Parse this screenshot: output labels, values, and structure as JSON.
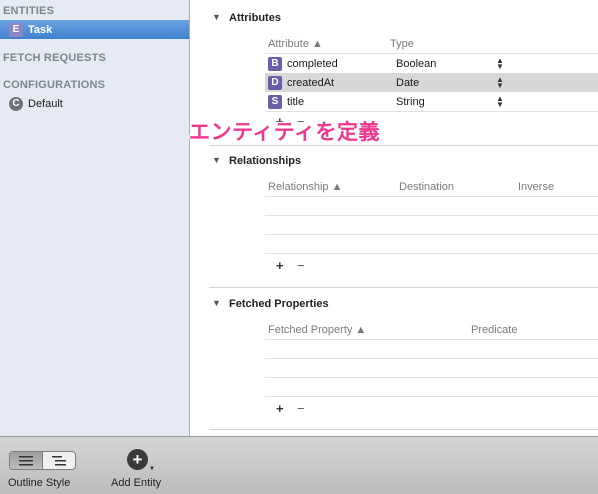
{
  "sidebar": {
    "entities_header": "ENTITIES",
    "entities": [
      {
        "badge": "E",
        "label": "Task"
      }
    ],
    "fetch_requests_header": "FETCH REQUESTS",
    "configurations_header": "CONFIGURATIONS",
    "configurations": [
      {
        "badge": "C",
        "label": "Default"
      }
    ]
  },
  "attributes": {
    "title": "Attributes",
    "col_attribute": "Attribute ▲",
    "col_type": "Type",
    "rows": [
      {
        "badge": "B",
        "name": "completed",
        "type": "Boolean"
      },
      {
        "badge": "D",
        "name": "createdAt",
        "type": "Date"
      },
      {
        "badge": "S",
        "name": "title",
        "type": "String"
      }
    ],
    "add": "+",
    "remove": "−"
  },
  "relationships": {
    "title": "Relationships",
    "col_relationship": "Relationship ▲",
    "col_destination": "Destination",
    "col_inverse": "Inverse",
    "add": "+",
    "remove": "−"
  },
  "fetched_properties": {
    "title": "Fetched Properties",
    "col_fetched_property": "Fetched Property ▲",
    "col_predicate": "Predicate",
    "add": "+",
    "remove": "−"
  },
  "toolbar": {
    "outline_style_label": "Outline Style",
    "add_entity_label": "Add Entity",
    "add_icon": "+"
  },
  "overlay_caption": "エンティティを定義",
  "colors": {
    "selection": "#3f7fcf",
    "badge": "#6a5fa6",
    "caption": "#ee3a8c"
  }
}
